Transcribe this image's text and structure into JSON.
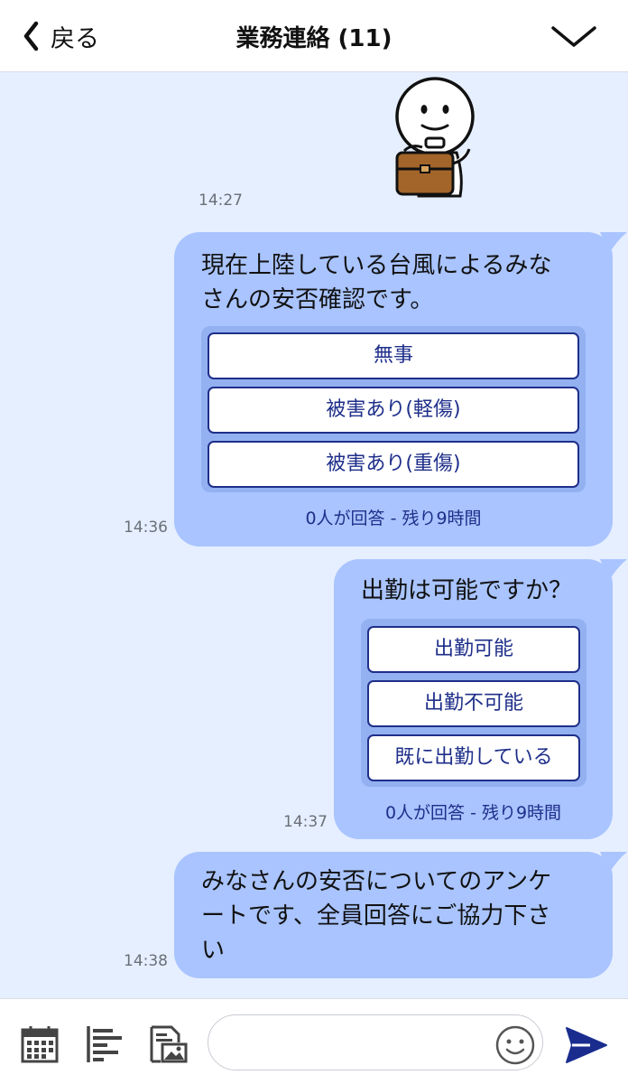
{
  "header": {
    "back_label": "戻る",
    "title": "業務連絡 (11)"
  },
  "messages": [
    {
      "type": "sticker",
      "time": "14:27"
    },
    {
      "type": "survey",
      "time": "14:36",
      "text_lines": [
        "現在上陸している台風によるみな",
        "さんの安否確認です。"
      ],
      "options": [
        "無事",
        "被害あり(軽傷)",
        "被害あり(重傷)"
      ],
      "status": "0人が回答 - 残り9時間"
    },
    {
      "type": "survey",
      "time": "14:37",
      "text_lines": [
        "出勤は可能ですか？"
      ],
      "options": [
        "出勤可能",
        "出勤不可能",
        "既に出勤している"
      ],
      "status": "0人が回答 - 残り9時間"
    },
    {
      "type": "text",
      "time": "14:38",
      "text_lines": [
        "みなさんの安否についてのアンケ",
        "ートです、全員回答にご協力下さ",
        "い"
      ]
    }
  ],
  "composer": {
    "input_value": "",
    "input_placeholder": ""
  },
  "icons": {
    "back": "chevron-left-icon",
    "menu": "chevron-down-icon",
    "calendar": "calendar-icon",
    "survey": "bar-list-icon",
    "image": "image-file-icon",
    "emoji": "smiley-icon",
    "send": "send-icon"
  },
  "colors": {
    "chat_background": "#e6efff",
    "bubble": "#a9c4ff",
    "option_panel": "#93b0f0",
    "accent": "#1f2f8a",
    "send": "#1a2d8f"
  }
}
